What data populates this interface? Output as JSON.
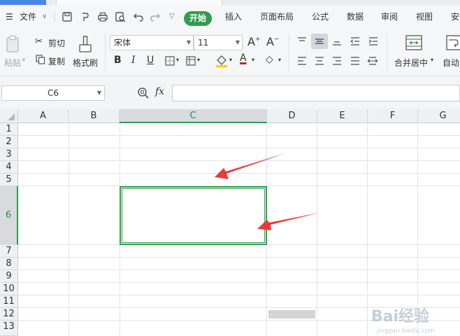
{
  "menu": {
    "file": "文件",
    "tabs": [
      "开始",
      "插入",
      "页面布局",
      "公式",
      "数据",
      "审阅",
      "视图",
      "安"
    ]
  },
  "ribbon": {
    "paste": "粘贴",
    "cut": "剪切",
    "copy": "复制",
    "format_painter": "格式刷",
    "font_name": "宋体",
    "font_size": "11",
    "merge_center": "合并居中",
    "auto_wrap": "自动"
  },
  "formula_bar": {
    "name_box": "C6",
    "fx": "fx",
    "formula": ""
  },
  "sheet": {
    "columns": [
      "A",
      "B",
      "C",
      "D",
      "E",
      "F",
      "G"
    ],
    "selected_column": "C",
    "rows": [
      "1",
      "2",
      "3",
      "4",
      "5",
      "6",
      "7",
      "8",
      "9",
      "10",
      "11",
      "12",
      "13"
    ],
    "selected_row": "6",
    "selected_cell": "C6"
  },
  "watermark": {
    "text": "Bai经验",
    "subtext": "jingyan.baidu.com"
  },
  "colors": {
    "accent_green": "#2e9d4f",
    "annotation_red": "#e83a3a"
  }
}
